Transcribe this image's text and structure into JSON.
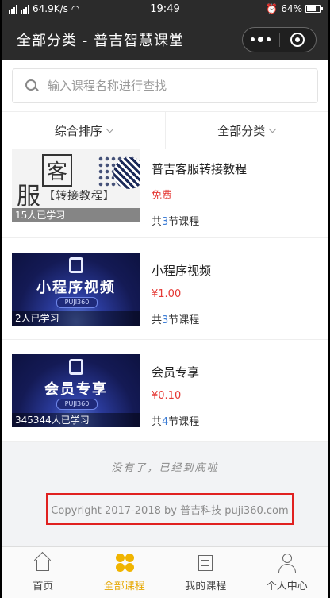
{
  "status_bar": {
    "net_speed": "64.9K/s",
    "time": "19:49",
    "battery": "64%"
  },
  "navbar": {
    "title": "全部分类 - 普吉智慧课堂"
  },
  "search": {
    "placeholder": "输入课程名称进行查找"
  },
  "filters": [
    {
      "label": "综合排序"
    },
    {
      "label": "全部分类"
    }
  ],
  "courses": [
    {
      "title": "普吉客服转接教程",
      "price": "免费",
      "count_prefix": "共",
      "count": "3",
      "count_suffix": "节课程",
      "learners": "15人已学习",
      "thumb": {
        "big1": "服",
        "big2": "客",
        "sub": "【转接教程】"
      }
    },
    {
      "title": "小程序视频",
      "price": "¥1.00",
      "count_prefix": "共",
      "count": "3",
      "count_suffix": "节课程",
      "learners": "2人已学习",
      "thumb": {
        "main": "小程序视频",
        "sub": "PUJI360"
      }
    },
    {
      "title": "会员专享",
      "price": "¥0.10",
      "count_prefix": "共",
      "count": "4",
      "count_suffix": "节课程",
      "learners": "345344人已学习",
      "thumb": {
        "main": "会员专享",
        "sub": "PUJI360"
      }
    }
  ],
  "end_note": "没有了，已经到底啦",
  "copyright": "Copyright 2017-2018 by 普吉科技 puji360.com",
  "tabbar": [
    {
      "label": "首页",
      "icon": "home-icon"
    },
    {
      "label": "全部课程",
      "icon": "category-icon",
      "active": true
    },
    {
      "label": "我的课程",
      "icon": "course-icon"
    },
    {
      "label": "个人中心",
      "icon": "user-icon"
    }
  ],
  "colors": {
    "accent": "#e6a700",
    "price": "#e53935",
    "count_number": "#3a7bd5",
    "highlight_box": "#e02020"
  }
}
